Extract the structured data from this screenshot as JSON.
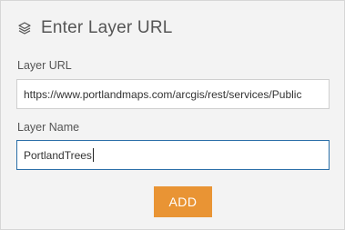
{
  "header": {
    "icon": "layers-icon",
    "title": "Enter Layer URL"
  },
  "layer_url": {
    "label": "Layer URL",
    "value": "https://www.portlandmaps.com/arcgis/rest/services/Public"
  },
  "layer_name": {
    "label": "Layer Name",
    "value": "PortlandTrees"
  },
  "actions": {
    "add_label": "ADD"
  },
  "colors": {
    "panel_bg": "#f3f3f3",
    "accent": "#e99434",
    "focus_border": "#2b6fa8"
  }
}
